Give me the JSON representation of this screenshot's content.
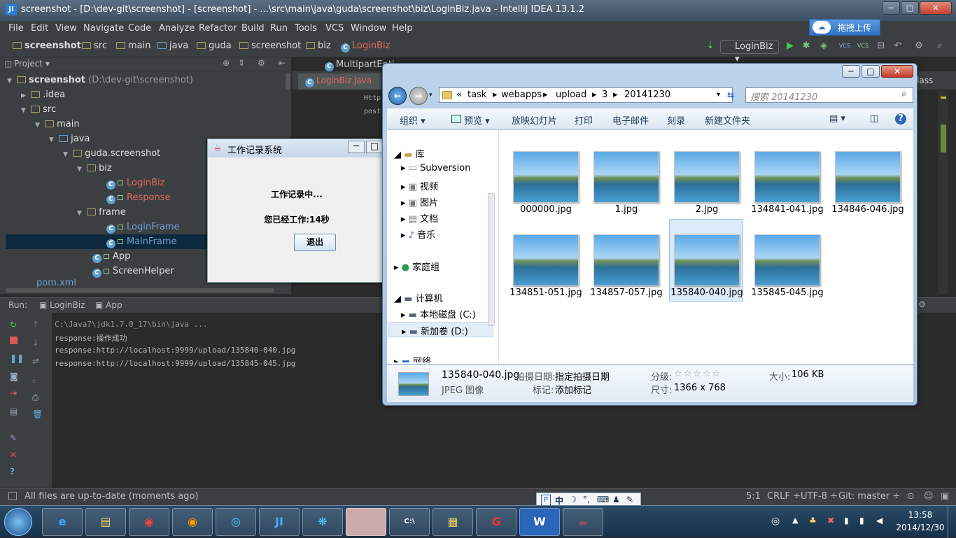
{
  "window": {
    "title": "screenshot - [D:\\dev-git\\screenshot] - [screenshot] - ...\\src\\main\\java\\guda\\screenshot\\biz\\LoginBiz.java - IntelliJ IDEA 13.1.2",
    "icon": "JI"
  },
  "upload_button": {
    "icon": "cloud-icon",
    "label": "拖拽上传"
  },
  "menu": [
    "File",
    "Edit",
    "View",
    "Navigate",
    "Code",
    "Analyze",
    "Refactor",
    "Build",
    "Run",
    "Tools",
    "VCS",
    "Window",
    "Help"
  ],
  "breadcrumb": [
    "screenshot",
    "src",
    "main",
    "java",
    "guda",
    "screenshot",
    "biz",
    "LoginBiz"
  ],
  "run_config": "LoginBiz",
  "project_panel": {
    "label": "Project"
  },
  "tree": [
    {
      "label": "screenshot",
      "suffix": " (D:\\dev-git\\screenshot)"
    },
    {
      "label": ".idea"
    },
    {
      "label": "src"
    },
    {
      "label": "main"
    },
    {
      "label": "java"
    },
    {
      "label": "guda.screenshot"
    },
    {
      "label": "biz"
    },
    {
      "label": "LoginBiz"
    },
    {
      "label": "Response"
    },
    {
      "label": "frame"
    },
    {
      "label": "LoginFrame"
    },
    {
      "label": "MainFrame"
    },
    {
      "label": "App"
    },
    {
      "label": "ScreenHelper"
    },
    {
      "label": "pom.xml"
    }
  ],
  "editor": {
    "tabs": [
      "LoginBiz.java",
      "MultipartEnti..."
    ],
    "right_tab": "lass",
    "code_lines": [
      "Http",
      "post"
    ]
  },
  "run_panel": {
    "label": "Run:",
    "tabs": [
      "LoginBiz",
      "App"
    ],
    "console": [
      "C:\\Java7\\jdk1.7.0_17\\bin\\java ...",
      "response:操作成功",
      "response:http://localhost:9999/upload/135840-040.jpg",
      "response:http://localhost:9999/upload/135845-045.jpg"
    ]
  },
  "statusbar": {
    "message": "All files are up-to-date (moments ago)",
    "position": "5:1",
    "line_sep": "CRLF ÷",
    "encoding": "UTF-8 ÷",
    "git": "Git: master ÷"
  },
  "swing_dialog": {
    "title": "工作记录系统",
    "status": "工作记录中...",
    "elapsed": "您已经工作:14秒",
    "exit": "退出"
  },
  "explorer": {
    "path": [
      "«",
      "task",
      "webapps",
      "upload",
      "3",
      "20141230"
    ],
    "search_placeholder": "搜索 20141230",
    "commands": [
      "组织 ▾",
      "预览 ▾",
      "放映幻灯片",
      "打印",
      "电子邮件",
      "刻录",
      "新建文件夹"
    ],
    "nav": [
      "库",
      "Subversion",
      "视频",
      "图片",
      "文档",
      "音乐",
      "家庭组",
      "计算机",
      "本地磁盘 (C:)",
      "新加卷 (D:)",
      "网络"
    ],
    "files": [
      "000000.jpg",
      "1.jpg",
      "2.jpg",
      "134841-041.jpg",
      "134846-046.jpg",
      "134851-051.jpg",
      "134857-057.jpg",
      "135840-040.jpg",
      "135845-045.jpg"
    ],
    "selected_index": 7,
    "details": {
      "name": "135840-040.jpg",
      "type": "JPEG 图像",
      "date_label": "拍摄日期:",
      "date_value": "指定拍摄日期",
      "tags_label": "标记:",
      "tags_value": "添加标记",
      "rating_label": "分级:",
      "rating": 0,
      "size_label": "大小:",
      "size_value": "106 KB",
      "dim_label": "尺寸:",
      "dim_value": "1366 x 768"
    }
  },
  "ime_bar": {
    "label": "中"
  },
  "taskbar": {
    "apps": [
      "ie-icon",
      "explorer-icon",
      "chrome-icon",
      "firefox-icon",
      "app-icon",
      "intellij-icon",
      "app2-icon",
      "photo-icon",
      "cmd-icon",
      "app3-icon",
      "app4-icon",
      "wps-icon",
      "java-icon"
    ],
    "time": "13:58",
    "date": "2014/12/30"
  }
}
